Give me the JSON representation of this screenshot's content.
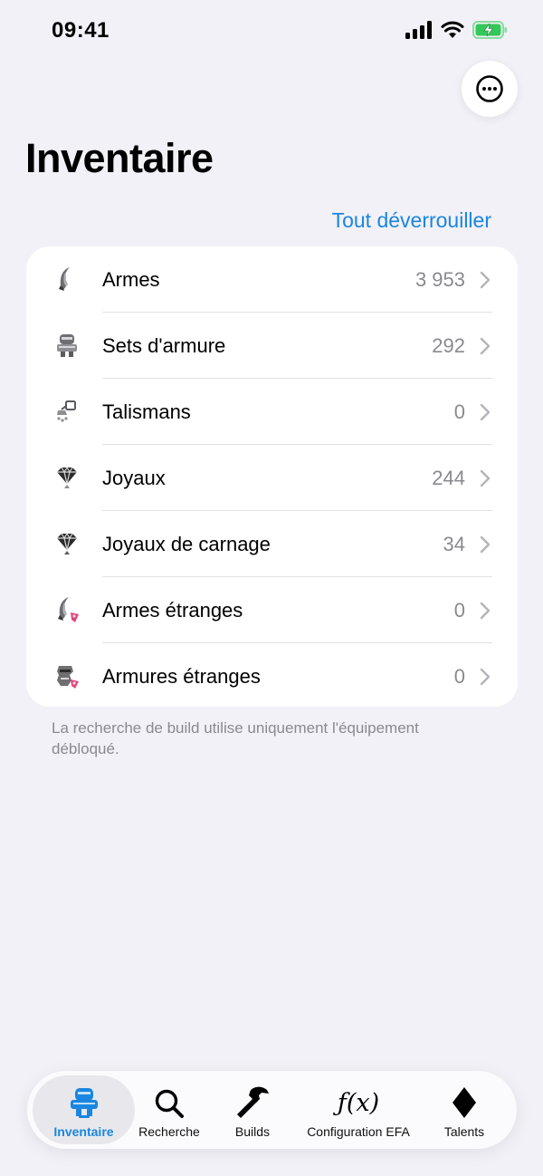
{
  "status_bar": {
    "time": "09:41"
  },
  "header": {
    "title": "Inventaire",
    "unlock_all_label": "Tout déverrouiller"
  },
  "inventory": {
    "items": [
      {
        "label": "Armes",
        "count": "3 953",
        "icon": "weapon-icon"
      },
      {
        "label": "Sets d'armure",
        "count": "292",
        "icon": "armor-set-icon"
      },
      {
        "label": "Talismans",
        "count": "0",
        "icon": "talisman-icon"
      },
      {
        "label": "Joyaux",
        "count": "244",
        "icon": "jewel-icon"
      },
      {
        "label": "Joyaux de carnage",
        "count": "34",
        "icon": "carnage-jewel-icon"
      },
      {
        "label": "Armes étranges",
        "count": "0",
        "icon": "strange-weapon-icon"
      },
      {
        "label": "Armures étranges",
        "count": "0",
        "icon": "strange-armor-icon"
      }
    ],
    "footnote": "La recherche de build utilise uniquement l'équipement débloqué."
  },
  "tab_bar": {
    "tabs": [
      {
        "label": "Inventaire",
        "icon": "inventory-icon",
        "active": true
      },
      {
        "label": "Recherche",
        "icon": "search-icon",
        "active": false
      },
      {
        "label": "Builds",
        "icon": "hammer-icon",
        "active": false
      },
      {
        "label": "Configuration EFA",
        "icon": "function-icon",
        "active": false
      },
      {
        "label": "Talents",
        "icon": "diamond-icon",
        "active": false
      }
    ]
  },
  "colors": {
    "accent": "#1a86e0",
    "background": "#f2f1f7",
    "card": "#ffffff",
    "secondary_text": "#8a8a8e",
    "battery_green": "#34c759"
  }
}
